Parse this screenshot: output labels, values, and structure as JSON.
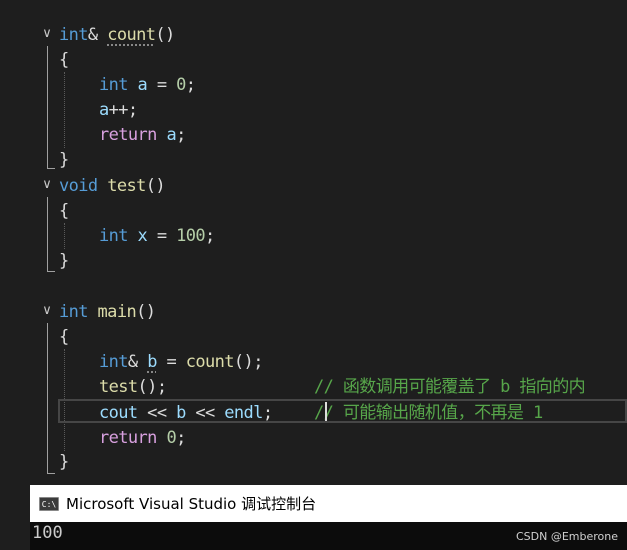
{
  "editor": {
    "lines": {
      "l1": {
        "t1": "int",
        "t2": "& ",
        "t3": "count",
        "t4": "()"
      },
      "l2": {
        "t1": "{"
      },
      "l3": {
        "t1": "int",
        "t2": " ",
        "t3": "a",
        "t4": " = ",
        "t5": "0",
        "t6": ";"
      },
      "l4": {
        "t1": "a",
        "t2": "++;"
      },
      "l5": {
        "t1": "return",
        "t2": " ",
        "t3": "a",
        "t4": ";"
      },
      "l6": {
        "t1": "}"
      },
      "l7": {
        "t1": "void",
        "t2": " ",
        "t3": "test",
        "t4": "()"
      },
      "l8": {
        "t1": "{"
      },
      "l9": {
        "t1": "int",
        "t2": " ",
        "t3": "x",
        "t4": " = ",
        "t5": "100",
        "t6": ";"
      },
      "l10": {
        "t1": "}"
      },
      "l11": {
        "t1": "int",
        "t2": " ",
        "t3": "main",
        "t4": "()"
      },
      "l12": {
        "t1": "{"
      },
      "l13": {
        "t1": "int",
        "t2": "& ",
        "t3": "b",
        "t4": " = ",
        "t5": "count",
        "t6": "();"
      },
      "l14": {
        "t1": "test",
        "t2": "();",
        "t3": "// 函数调用可能覆盖了 b 指向的内"
      },
      "l15": {
        "t1": "cout",
        "t2": " << ",
        "t3": "b",
        "t4": " << ",
        "t5": "endl",
        "t6": ";",
        "t7": "// 可能输出随机值，不再是 1"
      },
      "l16": {
        "t1": "return",
        "t2": " ",
        "t3": "0",
        "t4": ";"
      },
      "l17": {
        "t1": "}"
      }
    },
    "fold_glyph": "∨"
  },
  "console": {
    "title": "Microsoft Visual Studio 调试控制台",
    "icon_label": "C:\\",
    "output": "100"
  },
  "watermark": "CSDN @Emberone",
  "colors": {
    "keyword": "#569cd6",
    "control_keyword": "#d8a0df",
    "function": "#dcdcaa",
    "variable": "#9cdcfe",
    "number": "#b5cea8",
    "comment": "#57a64a",
    "background": "#1e1e1e"
  }
}
